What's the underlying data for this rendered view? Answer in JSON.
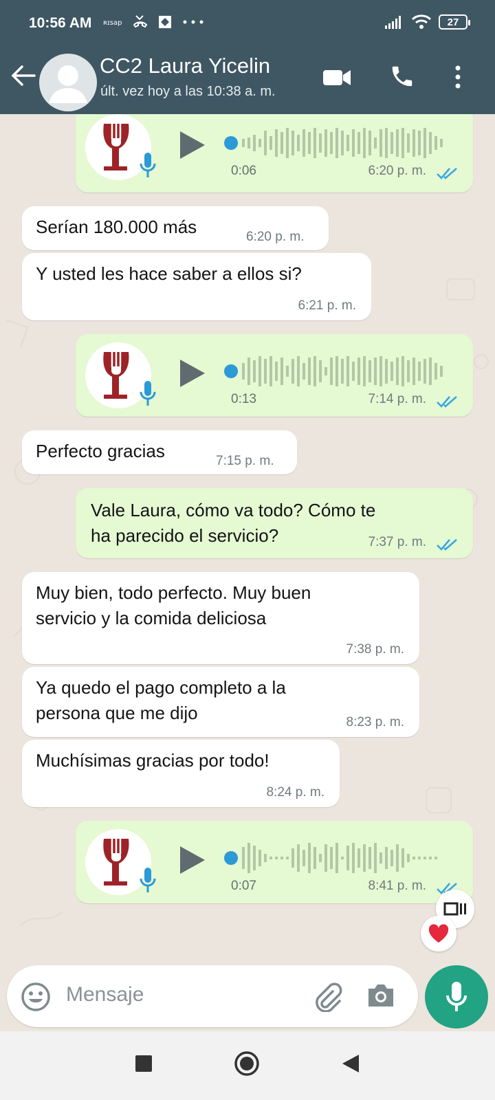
{
  "status_bar": {
    "time": "10:56 AM",
    "carrier_label": "ឱ៩ ៩",
    "battery": "27"
  },
  "header": {
    "contact_name": "CC2 Laura Yicelin",
    "last_seen": "últ. vez hoy a las 10:38 a. m."
  },
  "messages": [
    {
      "type": "audio",
      "direction": "out",
      "duration": "0:06",
      "time": "6:20 p. m.",
      "read": true
    },
    {
      "type": "text",
      "direction": "in",
      "text": "Serían 180.000 más",
      "time": "6:20 p. m."
    },
    {
      "type": "text",
      "direction": "in",
      "text": "Y usted les hace saber a ellos si?",
      "time": "6:21 p. m."
    },
    {
      "type": "audio",
      "direction": "out",
      "duration": "0:13",
      "time": "7:14 p. m.",
      "read": true
    },
    {
      "type": "text",
      "direction": "in",
      "text": "Perfecto gracias",
      "time": "7:15 p. m."
    },
    {
      "type": "text",
      "direction": "out",
      "lines": [
        "Vale Laura, cómo va todo? Cómo te",
        "ha parecido el servicio?"
      ],
      "time": "7:37 p. m.",
      "read": true
    },
    {
      "type": "text",
      "direction": "in",
      "lines": [
        "Muy bien, todo perfecto. Muy buen",
        "servicio y la comida deliciosa"
      ],
      "time": "7:38 p. m."
    },
    {
      "type": "text",
      "direction": "in",
      "lines": [
        "Ya quedo el pago completo a la",
        "persona que me dijo"
      ],
      "time": "8:23 p. m."
    },
    {
      "type": "text",
      "direction": "in",
      "text": "Muchísimas gracias por todo!",
      "time": "8:24 p. m."
    },
    {
      "type": "audio",
      "direction": "out",
      "duration": "0:07",
      "time": "8:41 p. m.",
      "read": true,
      "reaction": "heart"
    }
  ],
  "composer": {
    "placeholder": "Mensaje"
  },
  "icons": {
    "back": "arrow-left-icon",
    "video": "video-call-icon",
    "call": "phone-icon",
    "menu": "more-vert-icon",
    "emoji": "emoji-icon",
    "attach": "paperclip-icon",
    "camera": "camera-icon",
    "mic": "microphone-icon",
    "nav": [
      "square-icon",
      "circle-icon",
      "triangle-back-icon"
    ]
  },
  "colors": {
    "header": "#3f5663",
    "incoming": "#ffffff",
    "outgoing": "#e5f9d3",
    "accent": "#21a384",
    "read_ticks": "#35a7e0"
  }
}
